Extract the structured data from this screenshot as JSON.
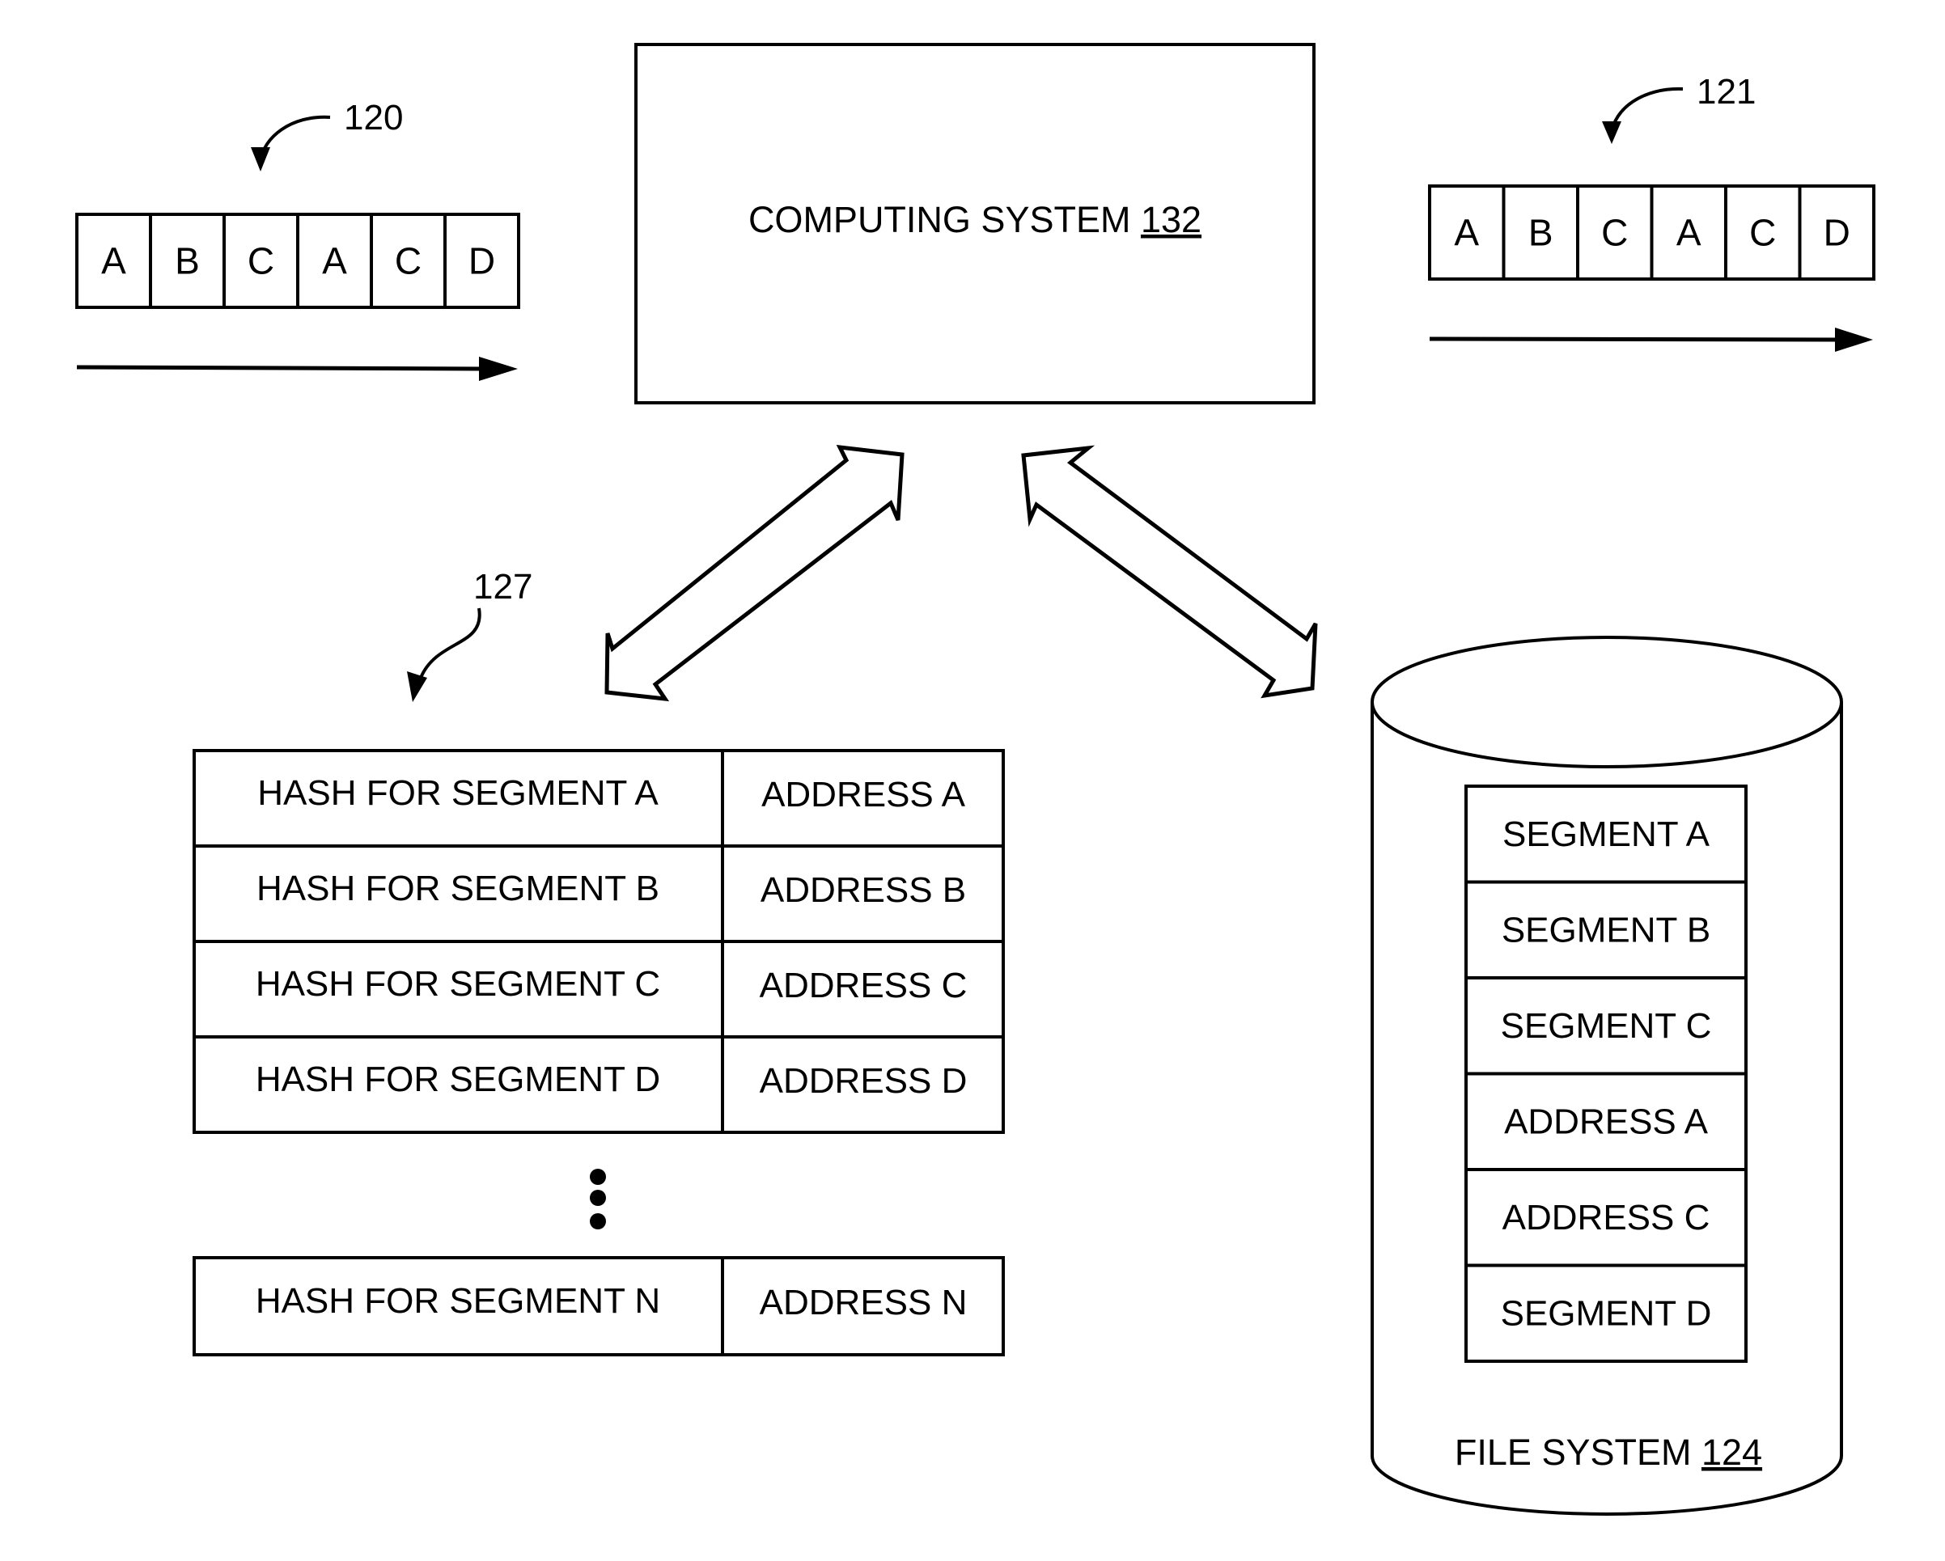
{
  "stream_input": {
    "ref": "120",
    "segments": [
      "A",
      "B",
      "C",
      "A",
      "C",
      "D"
    ]
  },
  "stream_output": {
    "ref": "121",
    "segments": [
      "A",
      "B",
      "C",
      "A",
      "C",
      "D"
    ]
  },
  "computing_system": {
    "label": "COMPUTING SYSTEM ",
    "ref": "132"
  },
  "hash_table": {
    "ref": "127",
    "rows": [
      {
        "hash": "HASH FOR SEGMENT A",
        "address": "ADDRESS A"
      },
      {
        "hash": "HASH FOR SEGMENT B",
        "address": "ADDRESS B"
      },
      {
        "hash": "HASH FOR SEGMENT C",
        "address": "ADDRESS C"
      },
      {
        "hash": "HASH FOR SEGMENT D",
        "address": "ADDRESS D"
      }
    ],
    "last_row": {
      "hash": "HASH FOR SEGMENT N",
      "address": "ADDRESS N"
    }
  },
  "file_system": {
    "label": "FILE SYSTEM ",
    "ref": "124",
    "entries": [
      "SEGMENT A",
      "SEGMENT B",
      "SEGMENT C",
      "ADDRESS A",
      "ADDRESS C",
      "SEGMENT D"
    ]
  }
}
